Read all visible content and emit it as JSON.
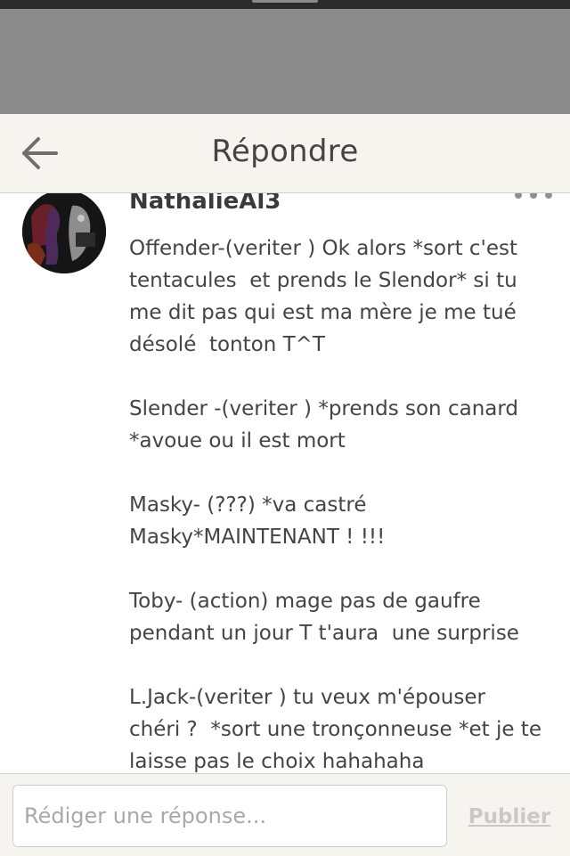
{
  "header": {
    "title": "Répondre",
    "back_icon": "arrow-left-icon"
  },
  "comment": {
    "username": "NathalieAl3",
    "avatar_icon": "user-avatar",
    "more_icon": "more-dots-icon",
    "lines": [
      "Offender-(veriter ) Ok alors *sort c'est",
      "tentacules  et prends le Slendor* si tu",
      "me dit pas qui est ma mère je me tué",
      "désolé  tonton T^T",
      "",
      "Slender -(veriter ) *prends son canard",
      "*avoue ou il est mort",
      "",
      "Masky- (???) *va castré",
      "Masky*MAINTENANT ! !!!",
      "",
      "Toby- (action) mage pas de gaufre",
      "pendant un jour T t'aura  une surprise",
      "",
      "L.Jack-(veriter ) tu veux m'épouser",
      "chéri ?  *sort une tronçonneuse *et je te",
      "laisse pas le choix hahahaha"
    ]
  },
  "reply": {
    "placeholder": "Rédiger une réponse...",
    "value": "",
    "publish_label": "Publier"
  },
  "colors": {
    "header_bg": "#f5f4ef",
    "overlay": "#8c8c8c",
    "text": "#444444",
    "publish_disabled": "#c9c9c9"
  }
}
